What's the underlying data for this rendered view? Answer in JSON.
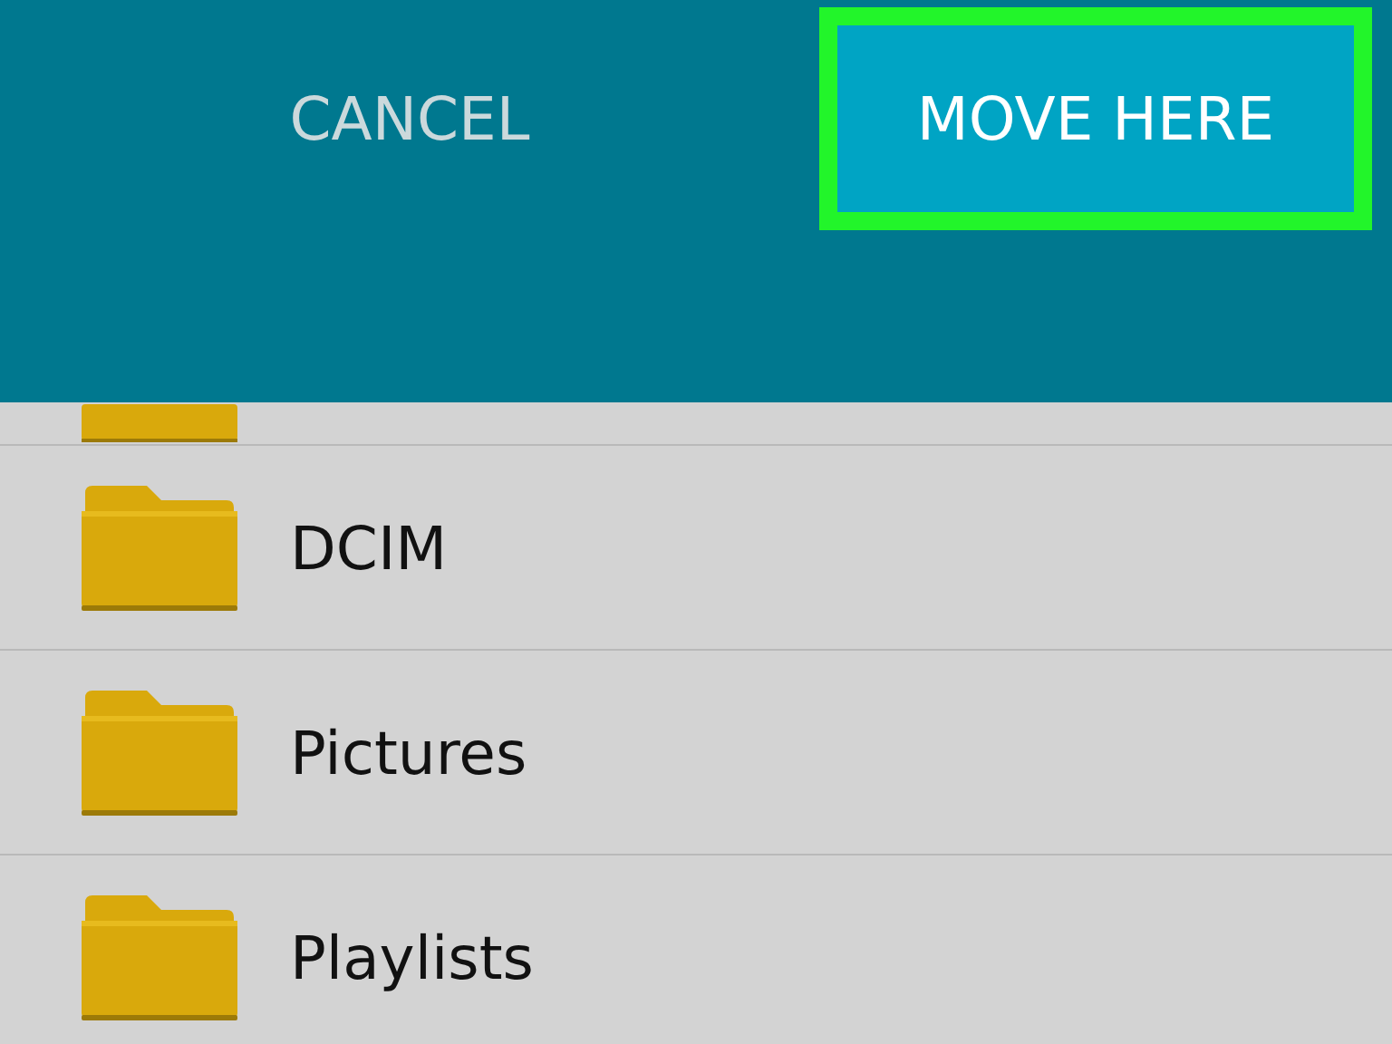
{
  "action_bar": {
    "buttons": [
      {
        "label": "CANCEL",
        "highlighted": false
      },
      {
        "label": "MOVE HERE",
        "highlighted": true
      }
    ]
  },
  "folders": [
    {
      "name": "DCIM"
    },
    {
      "name": "Pictures"
    },
    {
      "name": "Playlists"
    }
  ]
}
